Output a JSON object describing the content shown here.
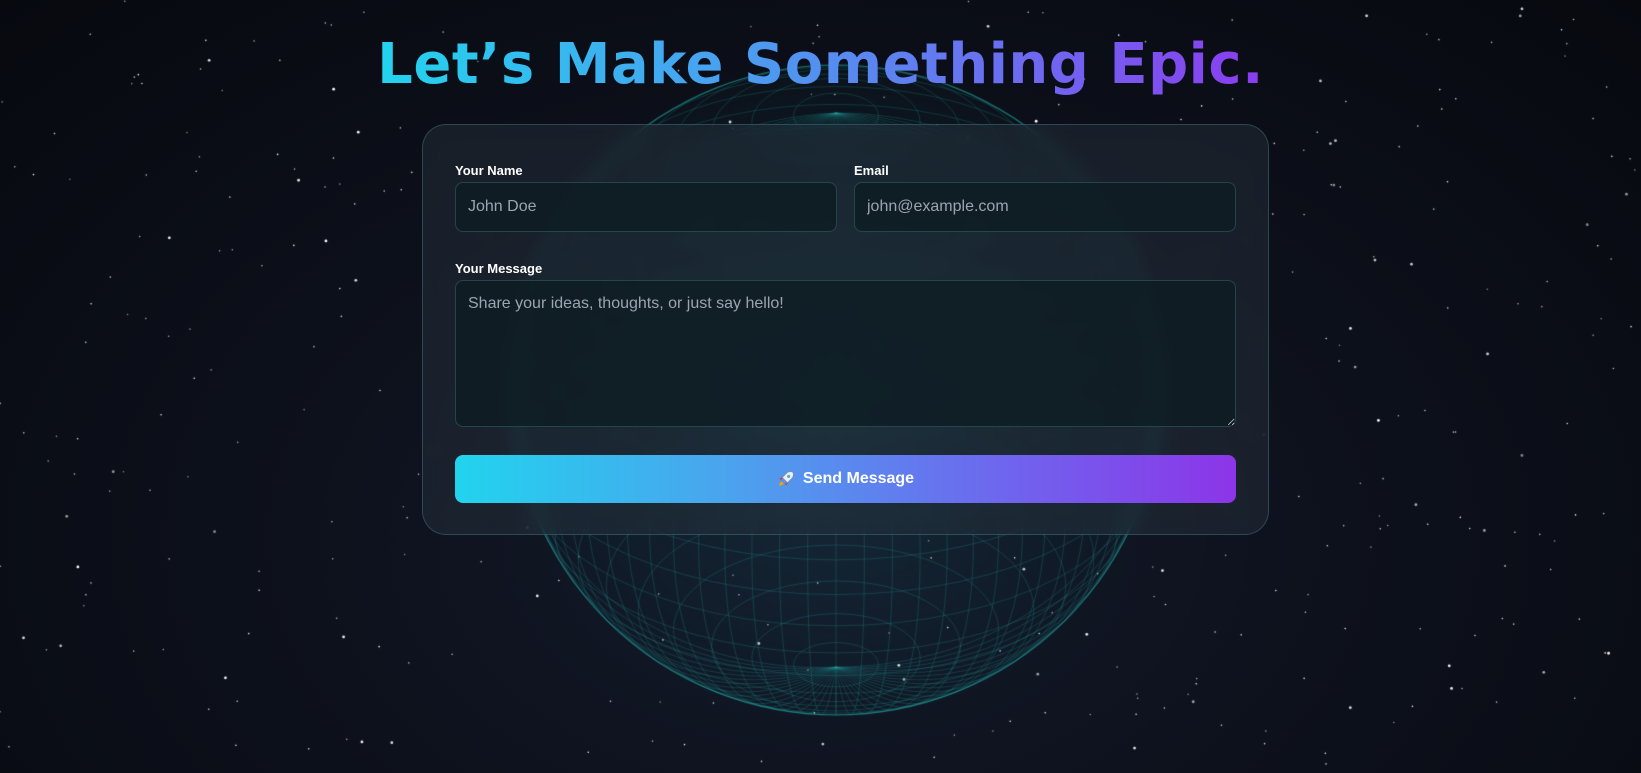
{
  "headline": "Let’s Make Something Epic.",
  "form": {
    "name_label": "Your Name",
    "name_placeholder": "John Doe",
    "email_label": "Email",
    "email_placeholder": "john@example.com",
    "message_label": "Your Message",
    "message_placeholder": "Share your ideas, thoughts, or just say hello!",
    "submit_label": "Send Message",
    "submit_icon": "rocket-icon"
  },
  "colors": {
    "gradient_start": "#22d3ee",
    "gradient_end": "#8c35e8",
    "globe_wire": "#1fa5a0",
    "background": "#0d111c"
  }
}
